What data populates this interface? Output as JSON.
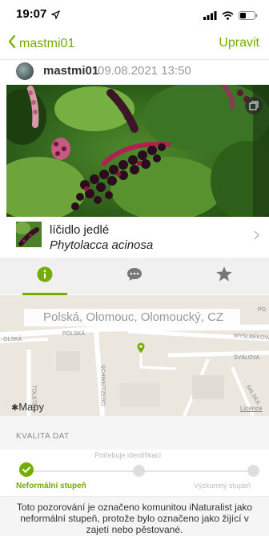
{
  "status_bar": {
    "time": "19:07"
  },
  "nav": {
    "back_label": "mastmi01",
    "edit_label": "Upravit"
  },
  "observation": {
    "user": "mastmi01",
    "date": "09.08.2021 13:50"
  },
  "taxon": {
    "common_name": "líčidlo jedlé",
    "scientific_name": "Phytolacca acinosa"
  },
  "tabs": [
    {
      "icon": "info-icon",
      "active": true
    },
    {
      "icon": "chat-icon",
      "active": false
    },
    {
      "icon": "star-icon",
      "active": false
    }
  ],
  "map": {
    "location": "Polská, Olomouc, Olomoucký, CZ",
    "street_labels": [
      "POLSKÁ",
      "OLSKÁ",
      "SCHWEITZERO",
      "TOLSTÉH",
      "MYSLBEKOVA",
      "ŠVÁLOVA",
      "SALSKÁ",
      "PO"
    ],
    "brand": "Mapy",
    "licence": "Licence"
  },
  "quality": {
    "title": "KVALITA DAT",
    "levels": [
      "Neformální stupeň",
      "Potřebuje identifikaci",
      "Výzkumný stupeň"
    ],
    "current_level": "Neformální stupeň",
    "description": "Toto pozorování je označeno komunitou iNaturalist jako neformální stupeň, protože bylo označeno jako žijící v zajetí nebo pěstované."
  },
  "colors": {
    "accent": "#74ac00",
    "bg_gray": "#f5f5f5"
  }
}
